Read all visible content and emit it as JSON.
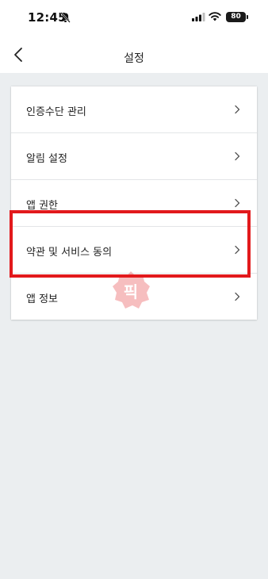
{
  "status": {
    "time": "12:45",
    "battery": "80"
  },
  "header": {
    "title": "설정"
  },
  "menu": {
    "items": [
      {
        "label": "인증수단 관리"
      },
      {
        "label": "알림 설정"
      },
      {
        "label": "앱 권한"
      },
      {
        "label": "약관 및 서비스 동의"
      },
      {
        "label": "앱 정보"
      }
    ]
  },
  "icons": {
    "back": "chevron-left-icon",
    "row": "chevron-right-icon",
    "bell": "bell-slash-icon",
    "signal": "cellular-signal-icon",
    "wifi": "wifi-icon",
    "battery": "battery-icon"
  },
  "colors": {
    "highlight": "#e2191c",
    "background": "#ebeef0",
    "watermark": "#e2191c"
  },
  "watermark": {
    "text": "픽"
  }
}
